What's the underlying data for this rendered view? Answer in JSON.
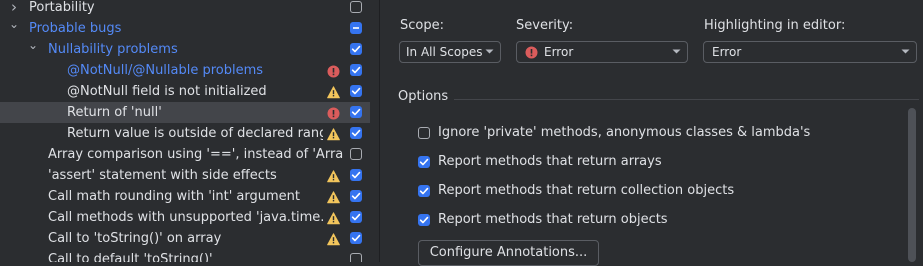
{
  "colors": {
    "background": "#2b2d30",
    "selection": "#43454a",
    "accent": "#3574f0",
    "group_text": "#548af7",
    "error": "#db5c5c",
    "warning": "#f2c55c"
  },
  "tree": {
    "rows": [
      {
        "label": "Portability",
        "level": 0,
        "expanded": false,
        "blue": false,
        "severity": null,
        "checkbox": "off",
        "selected": false
      },
      {
        "label": "Probable bugs",
        "level": 0,
        "expanded": true,
        "blue": true,
        "severity": null,
        "checkbox": "mixed",
        "selected": false
      },
      {
        "label": "Nullability problems",
        "level": 1,
        "expanded": true,
        "blue": true,
        "severity": null,
        "checkbox": "on",
        "selected": false
      },
      {
        "label": "@NotNull/@Nullable problems",
        "level": 2,
        "blue": true,
        "severity": "error",
        "checkbox": "on",
        "selected": false
      },
      {
        "label": "@NotNull field is not initialized",
        "level": 2,
        "blue": false,
        "severity": "warning",
        "checkbox": "on",
        "selected": false
      },
      {
        "label": "Return of 'null'",
        "level": 2,
        "blue": false,
        "severity": "error",
        "checkbox": "on",
        "selected": true
      },
      {
        "label": "Return value is outside of declared range",
        "level": 2,
        "blue": false,
        "severity": "warning",
        "checkbox": "on",
        "selected": false
      },
      {
        "label": "Array comparison using '==', instead of 'Arrays.equals()'",
        "level": 1,
        "blue": false,
        "severity": null,
        "checkbox": "off",
        "selected": false
      },
      {
        "label": "'assert' statement with side effects",
        "level": 1,
        "blue": false,
        "severity": "warning",
        "checkbox": "on",
        "selected": false
      },
      {
        "label": "Call math rounding with 'int' argument",
        "level": 1,
        "blue": false,
        "severity": "warning",
        "checkbox": "on",
        "selected": false
      },
      {
        "label": "Call methods with unsupported 'java.time.temporal.ChronoUnit' values",
        "level": 1,
        "blue": false,
        "severity": "warning",
        "checkbox": "on",
        "selected": false
      },
      {
        "label": "Call to 'toString()' on array",
        "level": 1,
        "blue": false,
        "severity": "warning",
        "checkbox": "on",
        "selected": false
      },
      {
        "label": "Call to default 'toString()'",
        "level": 1,
        "blue": false,
        "severity": null,
        "checkbox": "off",
        "selected": false
      }
    ]
  },
  "settings": {
    "scope_label": "Scope:",
    "scope_value": "In All Scopes",
    "severity_label": "Severity:",
    "severity_value": "Error",
    "highlight_label": "Highlighting in editor:",
    "highlight_value": "Error"
  },
  "options": {
    "title": "Options",
    "items": [
      {
        "label": "Ignore 'private' methods, anonymous classes & lambda's",
        "checked": false
      },
      {
        "label": "Report methods that return arrays",
        "checked": true
      },
      {
        "label": "Report methods that return collection objects",
        "checked": true
      },
      {
        "label": "Report methods that return objects",
        "checked": true
      }
    ],
    "configure_button": "Configure Annotations..."
  }
}
